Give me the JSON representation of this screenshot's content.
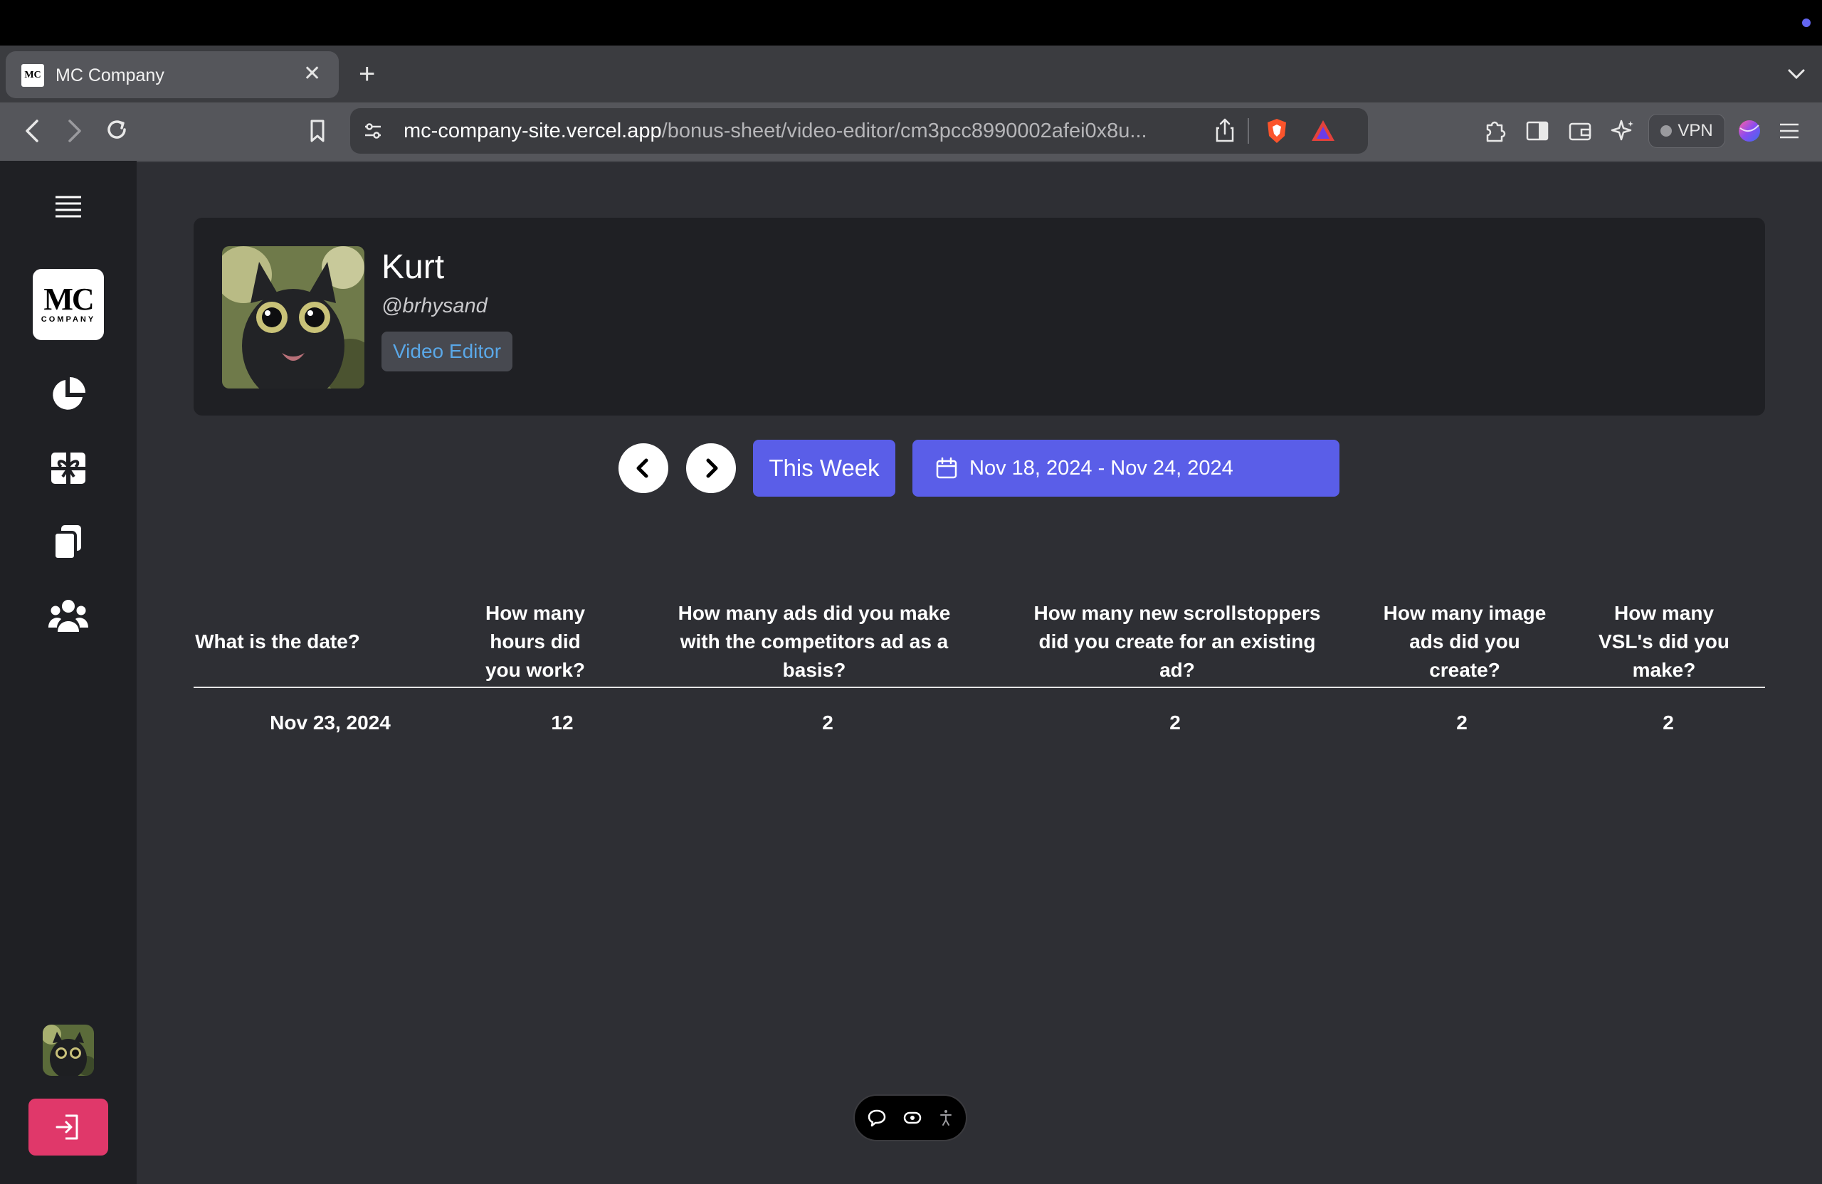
{
  "browser": {
    "tab": {
      "title": "MC Company",
      "favicon_text": "MC"
    },
    "address": {
      "host": "mc-company-site.vercel.app",
      "path": "/bonus-sheet/video-editor/cm3pcc8990002afei0x8u..."
    },
    "vpn_label": "VPN"
  },
  "sidebar": {
    "logo": {
      "top": "MC",
      "bottom": "COMPANY"
    },
    "items": [
      {
        "icon": "pie-chart-icon"
      },
      {
        "icon": "gift-icon"
      },
      {
        "icon": "copy-icon"
      },
      {
        "icon": "users-icon"
      }
    ]
  },
  "profile": {
    "name": "Kurt",
    "handle": "@brhysand",
    "role": "Video Editor"
  },
  "week_nav": {
    "this_week_label": "This Week",
    "date_range": "Nov 18, 2024 - Nov 24, 2024"
  },
  "table": {
    "headers": [
      "What is the date?",
      "How many hours did you work?",
      "How many ads did you make with the competitors ad as a basis?",
      "How many new scrollstoppers did you create for an existing ad?",
      "How many image ads did you create?",
      "How many VSL's did you make?"
    ],
    "rows": [
      [
        "Nov 23, 2024",
        "12",
        "2",
        "2",
        "2",
        "2"
      ]
    ]
  },
  "colors": {
    "accent": "#5a5ee8",
    "logout": "#e0386a",
    "role_text": "#5aa8e8"
  }
}
